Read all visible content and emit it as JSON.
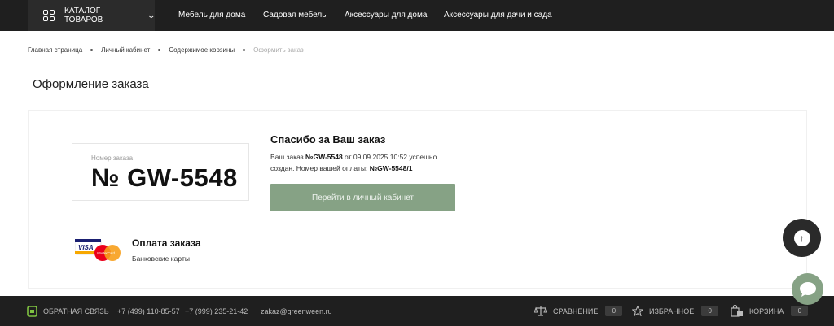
{
  "header": {
    "catalog_label": "КАТАЛОГ ТОВАРОВ",
    "nav": [
      "Мебель для дома",
      "Садовая мебель",
      "Аксессуары для дома",
      "Аксессуары для дачи и сада"
    ]
  },
  "breadcrumbs": [
    "Главная страница",
    "Личный кабинет",
    "Содержимое корзины",
    "Оформить заказ"
  ],
  "page_title": "Оформление заказа",
  "order": {
    "number_label": "Номер заказа",
    "number": "№ GW-5548",
    "thanks_title": "Спасибо за Ваш заказ",
    "text_prefix": "Ваш заказ ",
    "order_ref": "№GW-5548",
    "text_mid": " от 09.09.2025 10:52 успешно создан. Номер вашей оплаты: ",
    "payment_ref": "№GW-5548/1",
    "cabinet_button": "Перейти в личный кабинет"
  },
  "payment": {
    "title": "Оплата заказа",
    "method": "Банковские карты",
    "card_labels": [
      "VISA",
      "MasterCard"
    ]
  },
  "footer": {
    "feedback": "ОБРАТНАЯ СВЯЗЬ",
    "phone1": "+7 (499) 110-85-57",
    "phone2": "+7 (999) 235-21-42",
    "email": "zakaz@greenween.ru",
    "compare_label": "СРАВНЕНИЕ",
    "compare_count": "0",
    "favorites_label": "ИЗБРАННОЕ",
    "favorites_count": "0",
    "cart_label": "КОРЗИНА",
    "cart_count": "0"
  },
  "colors": {
    "accent": "#86a285",
    "dark": "#1f1f1f"
  }
}
